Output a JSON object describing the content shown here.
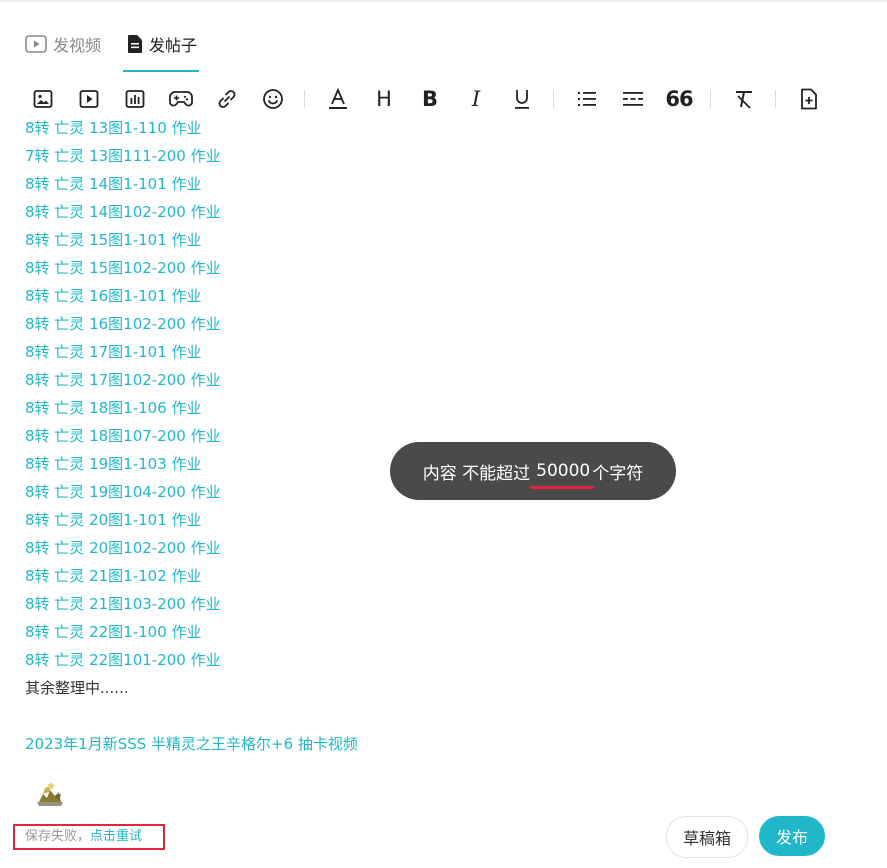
{
  "tabs": [
    {
      "label": "发视频",
      "active": false,
      "icon": "play-square-icon"
    },
    {
      "label": "发帖子",
      "active": true,
      "icon": "document-icon"
    }
  ],
  "toolbar": {
    "items": [
      "image-icon",
      "video-icon",
      "chart-icon",
      "gamepad-icon",
      "link-icon",
      "emoji-icon",
      "font-color-icon",
      "heading-icon",
      "bold-icon",
      "italic-icon",
      "underline-icon",
      "list-icon",
      "divider-icon",
      "quote-icon",
      "clear-format-icon",
      "add-document-icon"
    ],
    "heading_label": "H",
    "bold_label": "B",
    "italic_label": "I",
    "quote_label": "66"
  },
  "content": {
    "lines": [
      "8转 亡灵 13图1-110 作业",
      "7转 亡灵 13图111-200 作业",
      "8转 亡灵 14图1-101 作业",
      "8转 亡灵 14图102-200 作业",
      "8转 亡灵 15图1-101 作业",
      "8转 亡灵 15图102-200 作业",
      "8转 亡灵 16图1-101 作业",
      "8转 亡灵 16图102-200 作业",
      "8转 亡灵 17图1-101 作业",
      "8转 亡灵 17图102-200 作业",
      "8转 亡灵 18图1-106 作业",
      "8转 亡灵 18图107-200 作业",
      "8转 亡灵 19图1-103 作业",
      "8转 亡灵 19图104-200 作业",
      "8转 亡灵 20图1-101 作业",
      "8转 亡灵 20图102-200 作业",
      "8转 亡灵 21图1-102 作业",
      "8转 亡灵 21图103-200 作业",
      "8转 亡灵 22图1-100 作业",
      "8转 亡灵 22图101-200 作业"
    ],
    "note": "其余整理中......",
    "video_link": "2023年1月新SSS 半精灵之王辛格尔+6 抽卡视频"
  },
  "toast": {
    "prefix": "内容 不能超过",
    "number": "50000",
    "suffix": "个字符"
  },
  "footer": {
    "save_failed": "保存失败，",
    "retry": "点击重试",
    "draft_label": "草稿箱",
    "publish_label": "发布"
  },
  "colors": {
    "accent": "#20b8c8",
    "toast_bg": "#4a4a4a",
    "highlight_red": "#e0243a"
  }
}
